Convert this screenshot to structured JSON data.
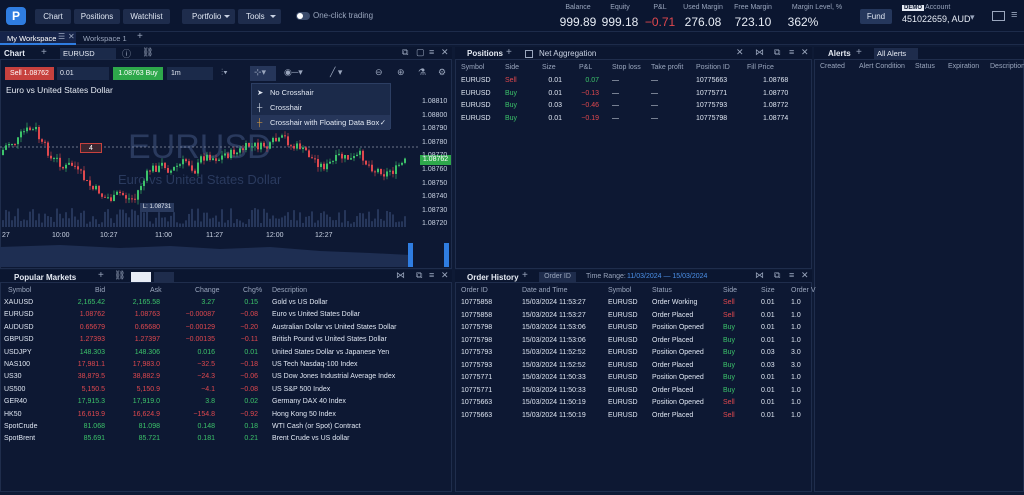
{
  "nav": {
    "portfolio": "Portfolio",
    "tools": "Tools",
    "chart": "Chart",
    "positions": "Positions",
    "watchlist": "Watchlist",
    "one_click": "One-click trading",
    "fund": "Fund",
    "demo": "DEMO",
    "account_label": "Account",
    "account_id": "451022659, AUD"
  },
  "account": [
    {
      "label": "Balance",
      "value": "999.89"
    },
    {
      "label": "Equity",
      "value": "999.18"
    },
    {
      "label": "P&L",
      "value": "−0.71"
    },
    {
      "label": "Used Margin",
      "value": "276.08"
    },
    {
      "label": "Free Margin",
      "value": "723.10"
    },
    {
      "label": "Margin Level, %",
      "value": "362%"
    }
  ],
  "tabs": [
    "My Workspace",
    "Workspace 1"
  ],
  "chart": {
    "title": "Chart",
    "symbol": "EURUSD",
    "sell": "Sell 1.08762",
    "qty": "0.01",
    "buy": "1.08763 Buy",
    "tf": "1m",
    "name": "Euro vs United States Dollar",
    "watermark": "EURUSD",
    "watermark_sub": "Euro vs United States Dollar",
    "order_marker": "4",
    "level_label": "L: 1.08731",
    "last_price": "1.08762",
    "price_labels": [
      "1.08810",
      "1.08800",
      "1.08790",
      "1.08780",
      "1.08770",
      "1.08760",
      "1.08750",
      "1.08740",
      "1.08730",
      "1.08720"
    ],
    "time_labels": [
      "27",
      "10:00",
      "10:27",
      "11:00",
      "11:27",
      "12:00",
      "12:27"
    ],
    "crosshair_menu": [
      "No Crosshair",
      "Crosshair",
      "Crosshair with Floating Data Box"
    ]
  },
  "positions": {
    "title": "Positions",
    "net": "Net Aggregation",
    "headers": [
      "Symbol",
      "Side",
      "Size",
      "P&L",
      "Stop loss",
      "Take profit",
      "Position ID",
      "Fill Price"
    ],
    "rows": [
      [
        "EURUSD",
        "Sell",
        "0.01",
        "0.07",
        "—",
        "—",
        "10775663",
        "1.08768"
      ],
      [
        "EURUSD",
        "Buy",
        "0.01",
        "−0.13",
        "—",
        "—",
        "10775771",
        "1.08770"
      ],
      [
        "EURUSD",
        "Buy",
        "0.03",
        "−0.46",
        "—",
        "—",
        "10775793",
        "1.08772"
      ],
      [
        "EURUSD",
        "Buy",
        "0.01",
        "−0.19",
        "—",
        "—",
        "10775798",
        "1.08774"
      ]
    ]
  },
  "alerts": {
    "title": "Alerts",
    "filter": "All Alerts",
    "headers": [
      "Created",
      "Alert Condition",
      "Status",
      "Expiration",
      "Description"
    ]
  },
  "markets": {
    "title": "Popular Markets",
    "headers": [
      "Symbol",
      "Bid",
      "Ask",
      "Change",
      "Chg%",
      "Description"
    ],
    "rows": [
      [
        "XAUUSD",
        "2,165.42",
        "2,165.58",
        "3.27",
        "0.15",
        "Gold vs US Dollar"
      ],
      [
        "EURUSD",
        "1.08762",
        "1.08763",
        "−0.00087",
        "−0.08",
        "Euro vs United States Dollar"
      ],
      [
        "AUDUSD",
        "0.65679",
        "0.65680",
        "−0.00129",
        "−0.20",
        "Australian Dollar vs United States Dollar"
      ],
      [
        "GBPUSD",
        "1.27393",
        "1.27397",
        "−0.00135",
        "−0.11",
        "British Pound vs United States Dollar"
      ],
      [
        "USDJPY",
        "148.303",
        "148.306",
        "0.016",
        "0.01",
        "United States Dollar vs Japanese Yen"
      ],
      [
        "NAS100",
        "17,981.1",
        "17,983.0",
        "−32.5",
        "−0.18",
        "US Tech Nasdaq-100 Index"
      ],
      [
        "US30",
        "38,879.5",
        "38,882.9",
        "−24.3",
        "−0.06",
        "US Dow Jones Industrial Average Index"
      ],
      [
        "US500",
        "5,150.5",
        "5,150.9",
        "−4.1",
        "−0.08",
        "US S&P 500 Index"
      ],
      [
        "GER40",
        "17,915.3",
        "17,919.0",
        "3.8",
        "0.02",
        "Germany DAX 40 Index"
      ],
      [
        "HK50",
        "16,619.9",
        "16,624.9",
        "−154.8",
        "−0.92",
        "Hong Kong 50 Index"
      ],
      [
        "SpotCrude",
        "81.068",
        "81.098",
        "0.148",
        "0.18",
        "WTI Cash (or Spot) Contract"
      ],
      [
        "SpotBrent",
        "85.691",
        "85.721",
        "0.181",
        "0.21",
        "Brent Crude vs US dollar"
      ]
    ]
  },
  "history": {
    "title": "Order History",
    "order_id": "Order ID",
    "time_range": "Time Range:",
    "range": "11/03/2024 — 15/03/2024",
    "headers": [
      "Order ID",
      "Date and Time",
      "Symbol",
      "Status",
      "Side",
      "Size",
      "Order V"
    ],
    "rows": [
      [
        "10775858",
        "15/03/2024 11:53:27",
        "EURUSD",
        "Order Working",
        "Sell",
        "0.01",
        "1.0"
      ],
      [
        "10775858",
        "15/03/2024 11:53:27",
        "EURUSD",
        "Order Placed",
        "Sell",
        "0.01",
        "1.0"
      ],
      [
        "10775798",
        "15/03/2024 11:53:06",
        "EURUSD",
        "Position Opened",
        "Buy",
        "0.01",
        "1.0"
      ],
      [
        "10775798",
        "15/03/2024 11:53:06",
        "EURUSD",
        "Order Placed",
        "Buy",
        "0.01",
        "1.0"
      ],
      [
        "10775793",
        "15/03/2024 11:52:52",
        "EURUSD",
        "Position Opened",
        "Buy",
        "0.03",
        "3.0"
      ],
      [
        "10775793",
        "15/03/2024 11:52:52",
        "EURUSD",
        "Order Placed",
        "Buy",
        "0.03",
        "3.0"
      ],
      [
        "10775771",
        "15/03/2024 11:50:33",
        "EURUSD",
        "Position Opened",
        "Buy",
        "0.01",
        "1.0"
      ],
      [
        "10775771",
        "15/03/2024 11:50:33",
        "EURUSD",
        "Order Placed",
        "Buy",
        "0.01",
        "1.0"
      ],
      [
        "10775663",
        "15/03/2024 11:50:19",
        "EURUSD",
        "Position Opened",
        "Sell",
        "0.01",
        "1.0"
      ],
      [
        "10775663",
        "15/03/2024 11:50:19",
        "EURUSD",
        "Order Placed",
        "Sell",
        "0.01",
        "1.0"
      ]
    ]
  }
}
